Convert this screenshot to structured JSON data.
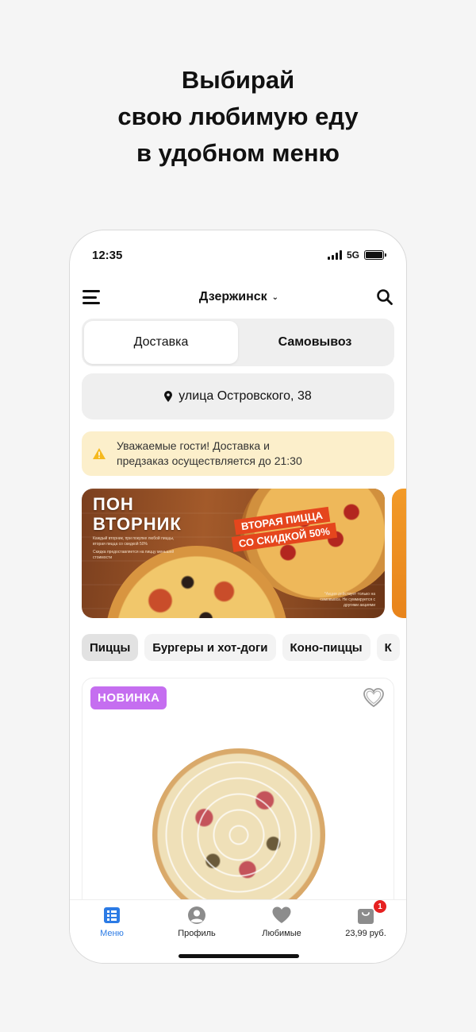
{
  "promo_headline": [
    "Выбирай",
    "свою любимую еду",
    "в удобном меню"
  ],
  "status_bar": {
    "time": "12:35",
    "network": "5G"
  },
  "header": {
    "city": "Дзержинск"
  },
  "order_mode": {
    "delivery": "Доставка",
    "pickup": "Самовывоз",
    "selected": "delivery"
  },
  "address": "улица Островского, 38",
  "notice": {
    "line1": "Уважаемые гости! Доставка и",
    "line2": "предзаказ осуществляется до 21:30"
  },
  "banner": {
    "title_line1": "ПОН",
    "title_line2": "ВТОРНИК",
    "small_text": "Каждый вторник, при покупке любой пиццы, вторая пицца со скидкой 50%",
    "small_text2": "Скидка предоставляется на пиццу меньшей стоимости",
    "promo_line1": "ВТОРАЯ ПИЦЦА",
    "promo_line2": "СО СКИДКОЙ 50%",
    "fine_print": "*Акция действует только на самовывоз. Не суммируется с другими акциями"
  },
  "categories": [
    "Пиццы",
    "Бургеры и хот-доги",
    "Коно-пиццы",
    "К"
  ],
  "product": {
    "badge": "НОВИНКА"
  },
  "tabbar": {
    "menu": "Меню",
    "profile": "Профиль",
    "favorites": "Любимые",
    "cart_total": "23,99 руб.",
    "cart_count": "1"
  },
  "colors": {
    "accent": "#2c7be5",
    "badge": "#c56ef0",
    "notice_bg": "#fcefcb",
    "cart_badge": "#e62020"
  }
}
